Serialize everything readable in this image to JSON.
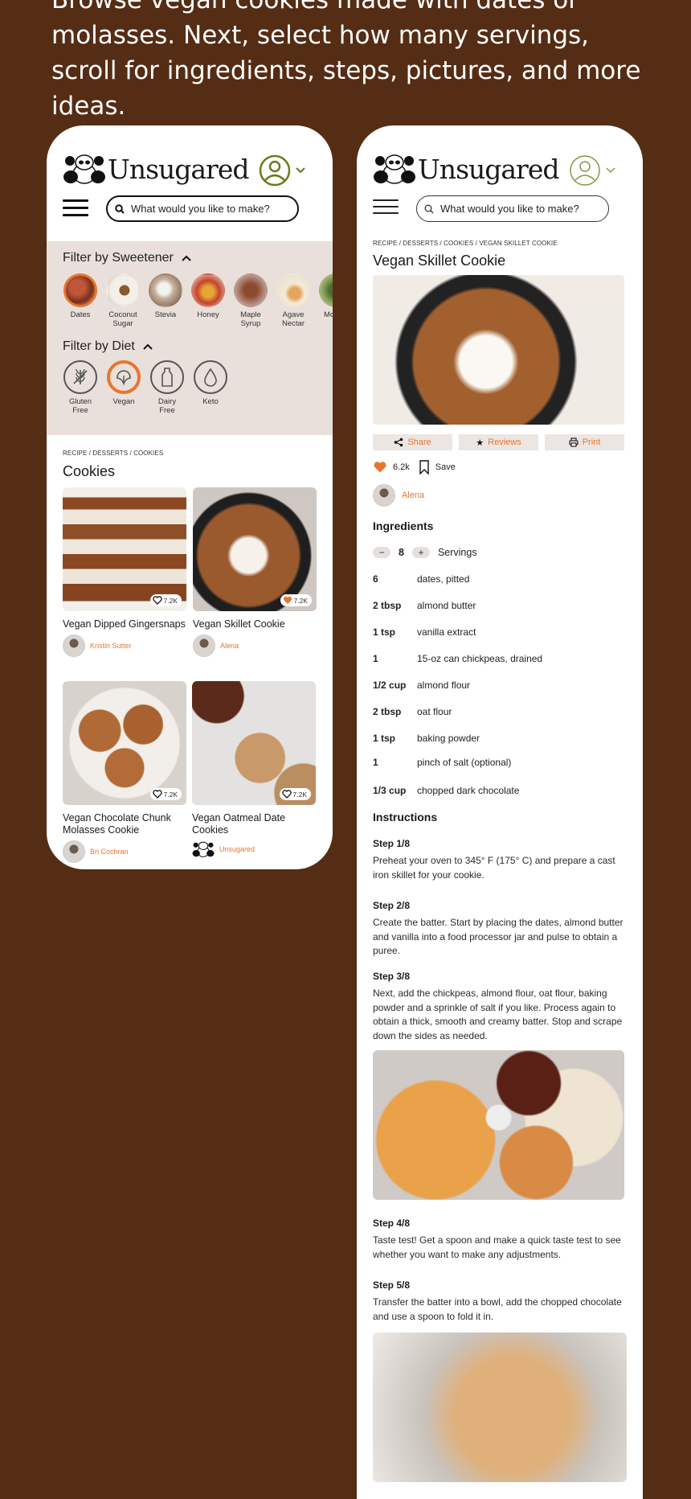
{
  "intro_text": "Browse vegan cookies made with dates or molasses. Next, select how many servings, scroll for ingredients, steps, pictures, and more ideas.",
  "brand": {
    "name": "Unsugared",
    "accent": "#e8752e",
    "account_color": "#6b7a1e",
    "background": "#552c14",
    "filter_bg": "#e9e0db"
  },
  "search": {
    "placeholder": "What would you like to make?"
  },
  "browse": {
    "sweetener_title": "Filter by Sweetener",
    "sweeteners": [
      {
        "label": "Dates",
        "selected": true
      },
      {
        "label": "Coconut Sugar",
        "selected": false
      },
      {
        "label": "Stevia",
        "selected": false
      },
      {
        "label": "Honey",
        "selected": false
      },
      {
        "label": "Maple Syrup",
        "selected": false
      },
      {
        "label": "Agave Nectar",
        "selected": false
      },
      {
        "label": "Mo Fre",
        "selected": false
      }
    ],
    "diet_title": "Filter by Diet",
    "diets": [
      {
        "label": "Gluten Free",
        "icon": "wheat-icon",
        "selected": false
      },
      {
        "label": "Vegan",
        "icon": "leaf-icon",
        "selected": true
      },
      {
        "label": "Dairy Free",
        "icon": "milk-bottle-icon",
        "selected": false
      },
      {
        "label": "Keto",
        "icon": "drop-icon",
        "selected": false
      }
    ],
    "breadcrumb": "RECIPE / DESSERTS / COOKIES",
    "section_title": "Cookies",
    "cards": [
      {
        "title": "Vegan Dipped Gingersnaps",
        "likes": "7.2K",
        "liked": false,
        "author": "Kristin Sutter"
      },
      {
        "title": "Vegan Skillet Cookie",
        "likes": "7.2K",
        "liked": true,
        "author": "Alena"
      },
      {
        "title": "Vegan Chocolate Chunk Molasses Cookie",
        "likes": "7.2K",
        "liked": false,
        "author": "Bri Cochran"
      },
      {
        "title": "Vegan Oatmeal Date Cookies",
        "likes": "7.2K",
        "liked": false,
        "author": "Unsugared"
      }
    ]
  },
  "recipe": {
    "breadcrumb": "RECIPE / DESSERTS / COOKIES / VEGAN SKILLET COOKIE",
    "title": "Vegan Skillet Cookie",
    "actions": {
      "share": "Share",
      "reviews": "Reviews",
      "print": "Print"
    },
    "likes": "6.2k",
    "save_label": "Save",
    "author": "Alena",
    "ingredients_title": "Ingredients",
    "servings": {
      "value": "8",
      "label": "Servings",
      "minus": "−",
      "plus": "+"
    },
    "ingredients": [
      {
        "qty": "6",
        "item": "dates, pitted"
      },
      {
        "qty": "2 tbsp",
        "item": "almond butter"
      },
      {
        "qty": "1 tsp",
        "item": "vanilla extract"
      },
      {
        "qty": "1",
        "item": "15-oz can chickpeas, drained"
      },
      {
        "qty": "1/2 cup",
        "item": "almond flour"
      },
      {
        "qty": "2 tbsp",
        "item": "oat flour"
      },
      {
        "qty": "1 tsp",
        "item": "baking powder"
      },
      {
        "qty": "1",
        "item": "pinch of salt (optional)"
      },
      {
        "qty": "1/3 cup",
        "item": "chopped dark chocolate"
      }
    ],
    "instructions_title": "Instructions",
    "steps": [
      {
        "label": "Step 1/8",
        "text": "Preheat your oven to 345° F (175° C) and prepare a cast iron skillet for your cookie."
      },
      {
        "label": "Step 2/8",
        "text": "Create the batter. Start by placing the dates, almond butter and vanilla into a food processor jar and pulse to obtain a puree."
      },
      {
        "label": "Step 3/8",
        "text": "Next, add the chickpeas, almond flour, oat flour, baking powder and a sprinkle of salt if you like. Process again to obtain a thick, smooth and creamy batter. Stop and scrape down the sides as needed."
      },
      {
        "label": "Step 4/8",
        "text": "Taste test! Get a spoon and make a quick taste test to see whether you want to make any adjustments."
      },
      {
        "label": "Step 5/8",
        "text": "Transfer the batter into a bowl, add the chopped chocolate and use a spoon to fold it in."
      }
    ]
  }
}
